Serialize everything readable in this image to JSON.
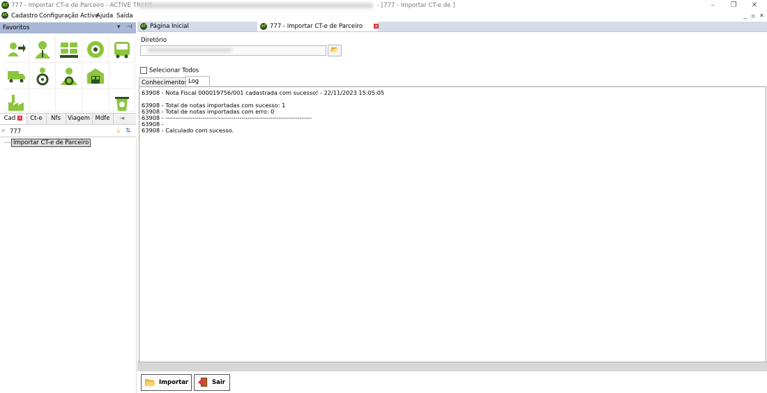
{
  "window": {
    "title": "777 - Importar CT-e de Parceiro - ACTIVE TRANS",
    "title_suffix": "- [777 - Importar CT-e de ]",
    "logo": "AT",
    "controls": [
      "–",
      "❐",
      "✕"
    ]
  },
  "menu": {
    "items": [
      "Cadastro",
      "Configuração Active",
      "Ajuda",
      "Saída"
    ],
    "mdi_controls": [
      "_",
      "▫",
      "✕"
    ]
  },
  "favorites": {
    "title": "Favoritos",
    "pin_glyphs": [
      "▾",
      "⊣"
    ],
    "icons": [
      "user-arrow-icon",
      "person-icon",
      "bus-group-icon",
      "tire-icon",
      "bus-icon",
      "truck-icon",
      "steering-person-icon",
      "driver-icon",
      "warehouse-icon",
      "factory-icon",
      "empty-slot",
      "empty-slot",
      "empty-slot",
      "empty-slot",
      "recycle-bin-icon"
    ]
  },
  "left_tabs": {
    "items": [
      "Cad",
      "Ct-e",
      "Nfs",
      "Viagem",
      "Mdfe"
    ],
    "close_glyph": "x",
    "scroll_glyph": "◄"
  },
  "search": {
    "value": "777",
    "icon_glyph": "⌕",
    "sort_glyphs": [
      "⇣",
      "⇅"
    ]
  },
  "tree": {
    "items": [
      "Importar CT-e de Parceiro"
    ]
  },
  "doc_tabs": {
    "items": [
      "Página Inicial",
      "777 - Importar CT-e de Parceiro"
    ],
    "close_glyph": "x"
  },
  "form": {
    "directory_label": "Diretório",
    "directory_value": "",
    "folder_glyph": "📂",
    "select_all_label": "Selecionar Todos",
    "select_all_checked": false
  },
  "content_tabs": {
    "items": [
      "Conhecimentos",
      "Log"
    ],
    "active": "Log"
  },
  "log": {
    "lines": [
      "63908 - Nota Fiscal 000019756/001 cadastrada com sucesso! - 22/11/2023 15:05:05",
      "",
      "63908 - Total de notas importadas com sucesso: 1",
      "63908 - Total de notas importadas com erro: 0",
      "63908 - -----------------------------------------------------------------------",
      "63908 -",
      "63908 - Calculado com sucesso."
    ]
  },
  "buttons": {
    "import_label": "Importar",
    "exit_label": "Sair"
  },
  "colors": {
    "accent_green": "#8cc63f",
    "header_blue": "#a9b8d6",
    "tab_strip": "#d6dbe9",
    "close_red": "#d9363e"
  }
}
